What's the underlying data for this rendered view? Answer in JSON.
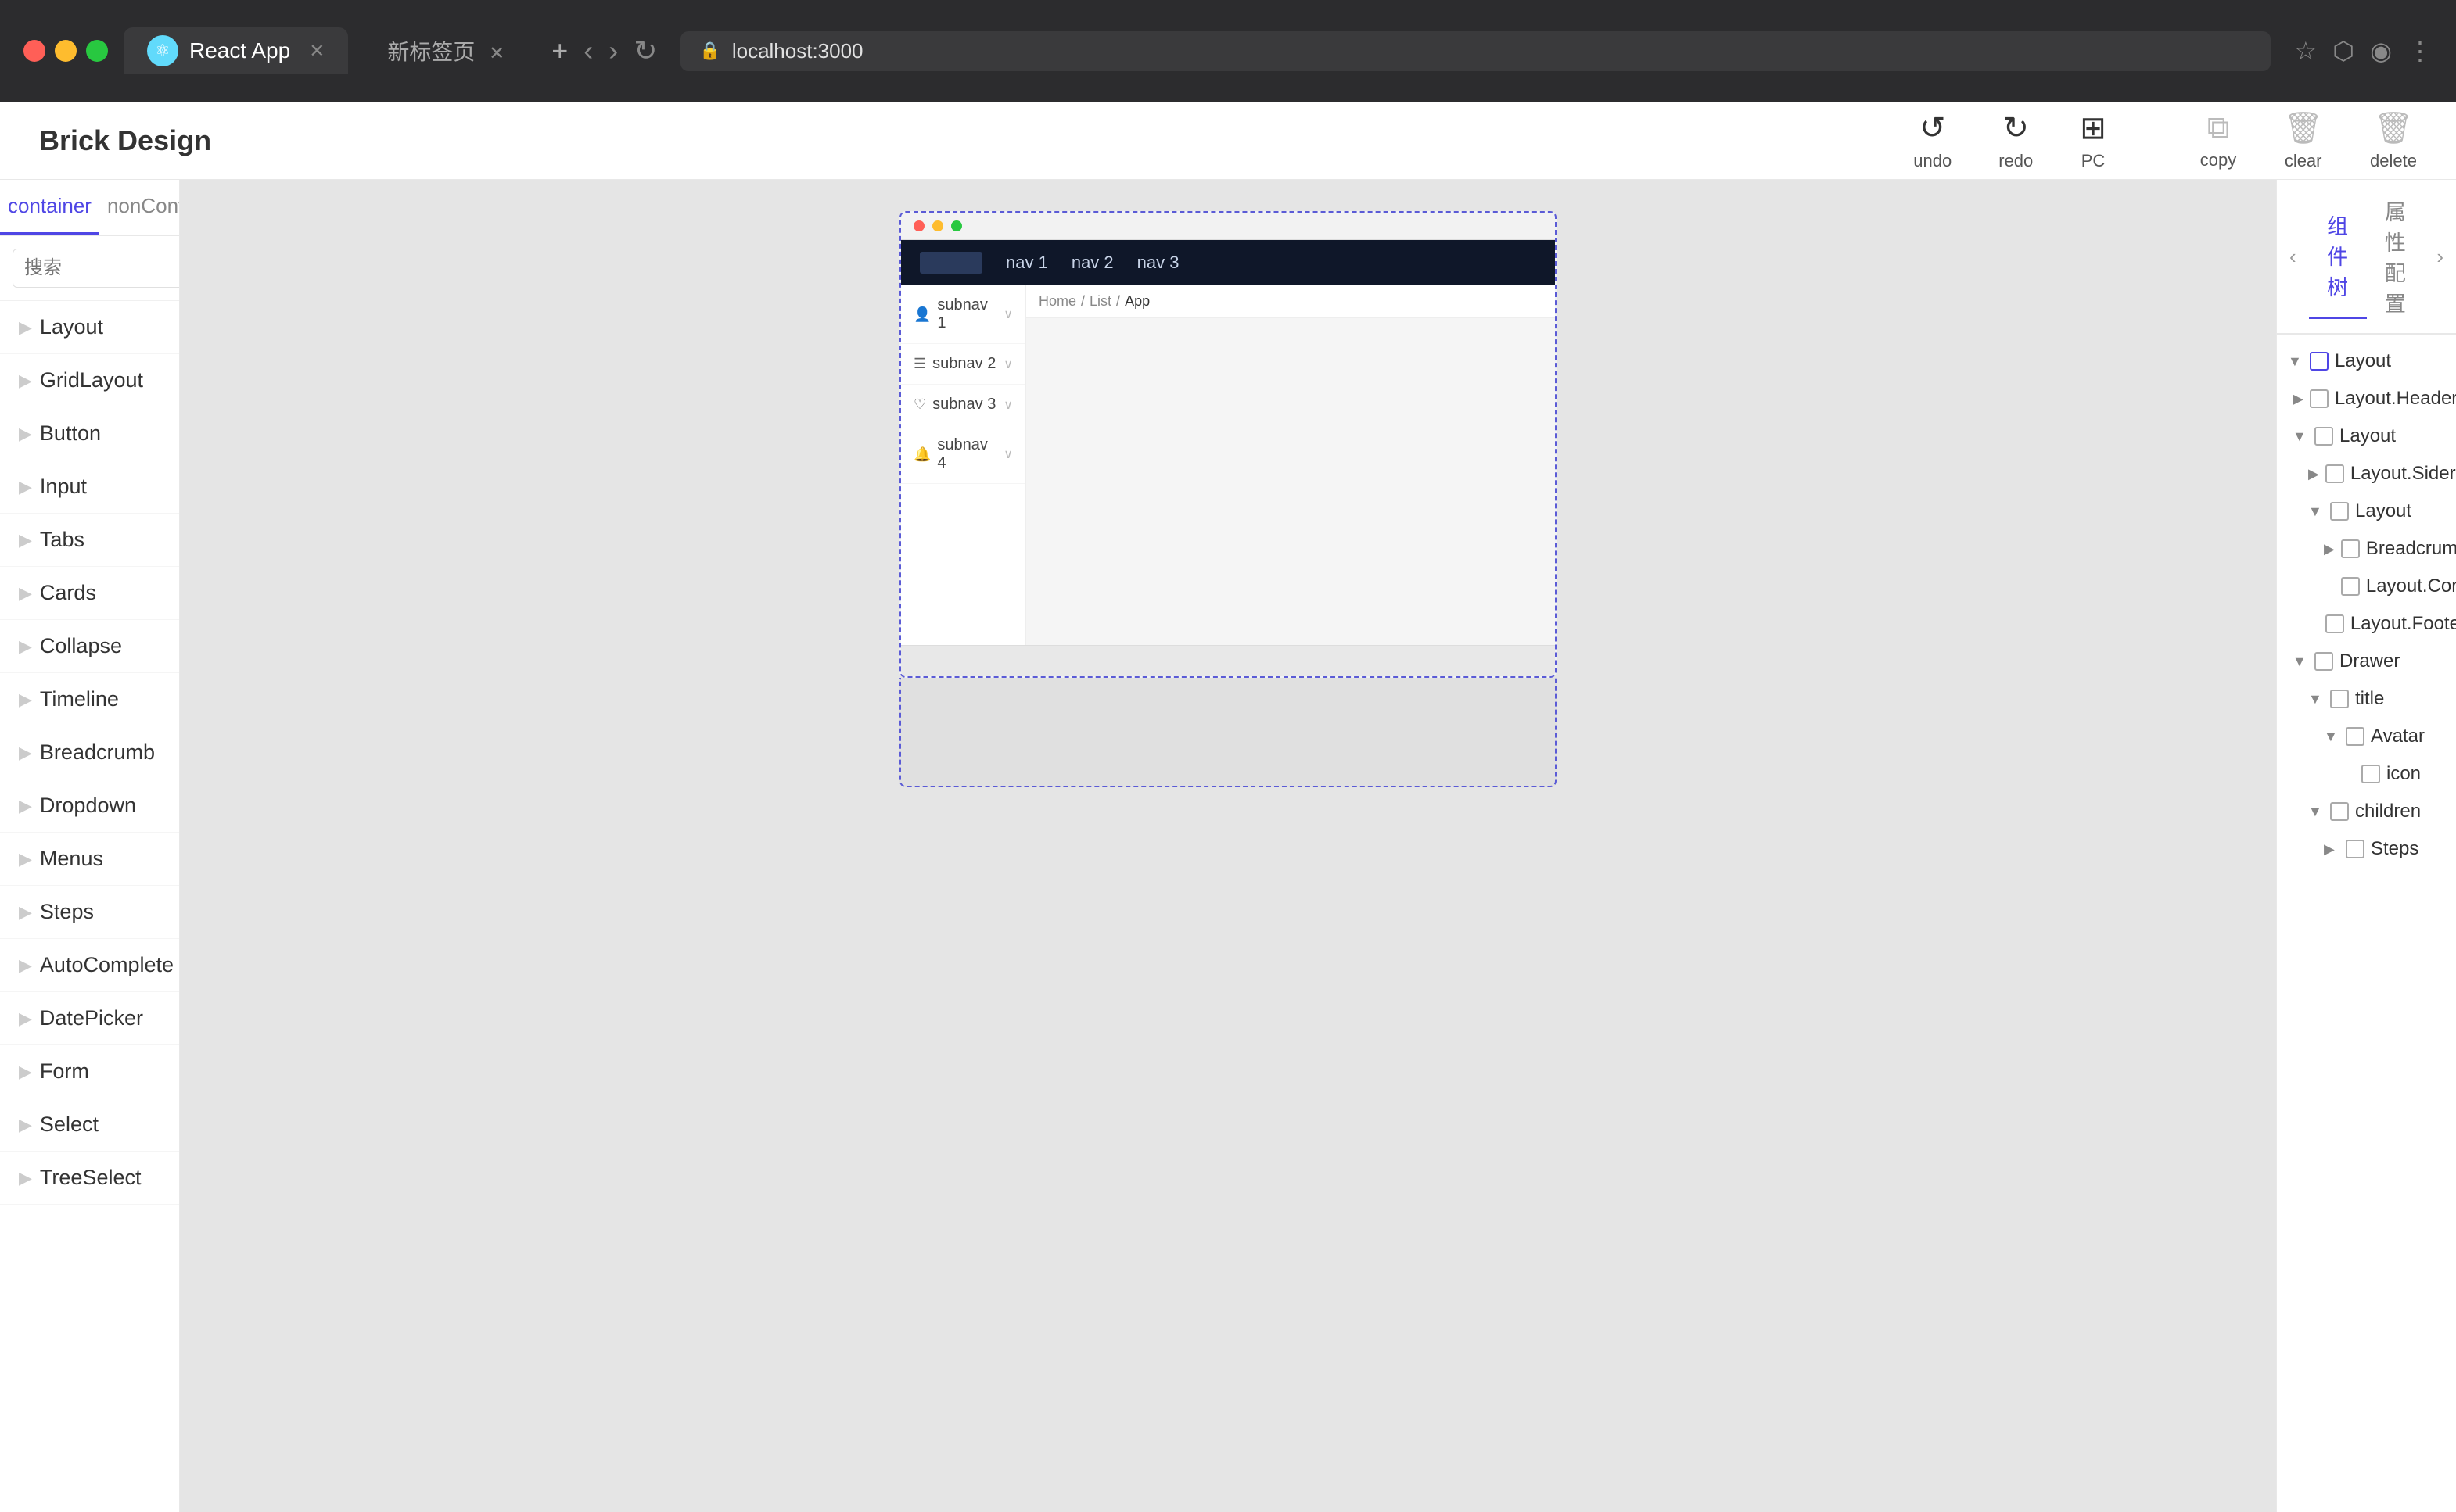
{
  "browser": {
    "tab1_label": "React App",
    "tab2_label": "新标签页",
    "address": "localhost:3000",
    "nav": {
      "back": "‹",
      "forward": "›",
      "reload": "↻"
    }
  },
  "app": {
    "title": "Brick Design",
    "toolbar": {
      "undo_label": "undo",
      "redo_label": "redo",
      "pc_label": "PC",
      "copy_label": "copy",
      "clear_label": "clear",
      "delete_label": "delete"
    }
  },
  "left_sidebar": {
    "tab1": "container",
    "tab2": "nonContainer",
    "search_placeholder": "搜索",
    "items": [
      {
        "label": "Layout"
      },
      {
        "label": "GridLayout"
      },
      {
        "label": "Button"
      },
      {
        "label": "Input"
      },
      {
        "label": "Tabs"
      },
      {
        "label": "Cards"
      },
      {
        "label": "Collapse"
      },
      {
        "label": "Timeline"
      },
      {
        "label": "Breadcrumb"
      },
      {
        "label": "Dropdown"
      },
      {
        "label": "Menus"
      },
      {
        "label": "Steps"
      },
      {
        "label": "AutoComplete"
      },
      {
        "label": "DatePicker"
      },
      {
        "label": "Form"
      },
      {
        "label": "Select"
      },
      {
        "label": "TreeSelect"
      }
    ]
  },
  "canvas": {
    "nav_items": [
      "nav 1",
      "nav 2",
      "nav 3"
    ],
    "subnav_items": [
      {
        "label": "subnav 1",
        "icon": "👤"
      },
      {
        "label": "subnav 2",
        "icon": "☰"
      },
      {
        "label": "subnav 3",
        "icon": "♡"
      },
      {
        "label": "subnav 4",
        "icon": "🔔"
      }
    ],
    "breadcrumb": {
      "home": "Home",
      "list": "List",
      "current": "App"
    }
  },
  "right_panel": {
    "tab1": "组件树",
    "tab2": "属性配置",
    "tree": [
      {
        "label": "Layout",
        "indent": 0,
        "expanded": true,
        "has_arrow": true
      },
      {
        "label": "Layout.Header",
        "indent": 1,
        "expanded": false,
        "has_arrow": true
      },
      {
        "label": "Layout",
        "indent": 1,
        "expanded": true,
        "has_arrow": true
      },
      {
        "label": "Layout.Sider",
        "indent": 2,
        "expanded": false,
        "has_arrow": true
      },
      {
        "label": "Layout",
        "indent": 2,
        "expanded": true,
        "has_arrow": true
      },
      {
        "label": "Breadcrumb",
        "indent": 3,
        "expanded": false,
        "has_arrow": true
      },
      {
        "label": "Layout.Content",
        "indent": 3,
        "expanded": false,
        "has_arrow": false
      },
      {
        "label": "Layout.Footer",
        "indent": 2,
        "expanded": false,
        "has_arrow": false
      },
      {
        "label": "Drawer",
        "indent": 1,
        "expanded": true,
        "has_arrow": true
      },
      {
        "label": "title",
        "indent": 2,
        "expanded": true,
        "has_arrow": true
      },
      {
        "label": "Avatar",
        "indent": 3,
        "expanded": true,
        "has_arrow": true
      },
      {
        "label": "icon",
        "indent": 4,
        "expanded": false,
        "has_arrow": false
      },
      {
        "label": "children",
        "indent": 2,
        "expanded": true,
        "has_arrow": true
      },
      {
        "label": "Steps",
        "indent": 3,
        "expanded": false,
        "has_arrow": true
      }
    ]
  }
}
